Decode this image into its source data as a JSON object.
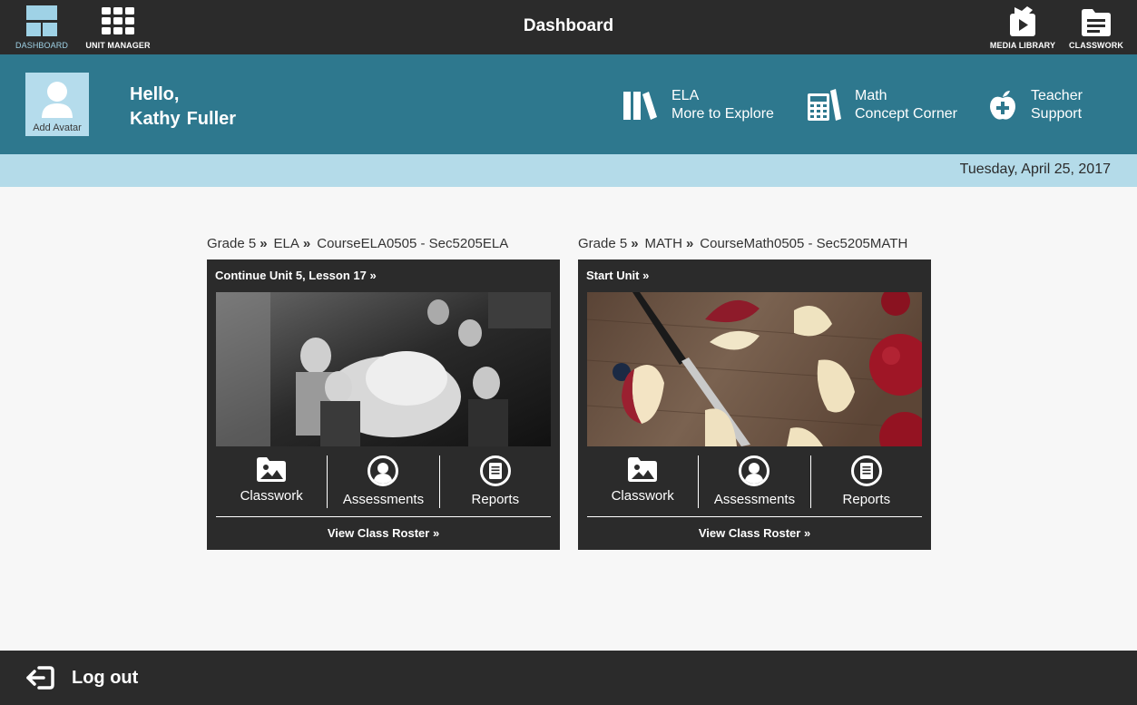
{
  "topbar": {
    "title": "Dashboard",
    "nav": {
      "dashboard": "DASHBOARD",
      "unit_manager": "UNIT MANAGER",
      "media_library": "MEDIA LIBRARY",
      "classwork": "CLASSWORK"
    }
  },
  "header": {
    "avatar_label": "Add Avatar",
    "greeting": "Hello,",
    "first_name": "Kathy",
    "last_name": "Fuller",
    "links": [
      {
        "line1": "ELA",
        "line2": "More to Explore",
        "icon": "books-icon"
      },
      {
        "line1": "Math",
        "line2": "Concept Corner",
        "icon": "calculator-icon"
      },
      {
        "line1": "Teacher",
        "line2": "Support",
        "icon": "apple-plus-icon"
      }
    ]
  },
  "date": "Tuesday, April 25, 2017",
  "courses": [
    {
      "breadcrumb": [
        "Grade 5",
        "ELA",
        "CourseELA0505 - Sec5205ELA"
      ],
      "continue_label": "Continue Unit 5, Lesson 17",
      "image": "historic-photo-children",
      "actions": {
        "classwork": "Classwork",
        "assessments": "Assessments",
        "reports": "Reports"
      },
      "roster_label": "View Class Roster"
    },
    {
      "breadcrumb": [
        "Grade 5",
        "MATH",
        "CourseMath0505 - Sec5205MATH"
      ],
      "continue_label": "Start Unit",
      "image": "sliced-apples-knife",
      "actions": {
        "classwork": "Classwork",
        "assessments": "Assessments",
        "reports": "Reports"
      },
      "roster_label": "View Class Roster"
    }
  ],
  "footer": {
    "logout_label": "Log out"
  },
  "colors": {
    "topbar": "#2b2b2b",
    "header": "#2e788e",
    "datebar": "#b4dbe9",
    "accent": "#9fd2e6"
  }
}
